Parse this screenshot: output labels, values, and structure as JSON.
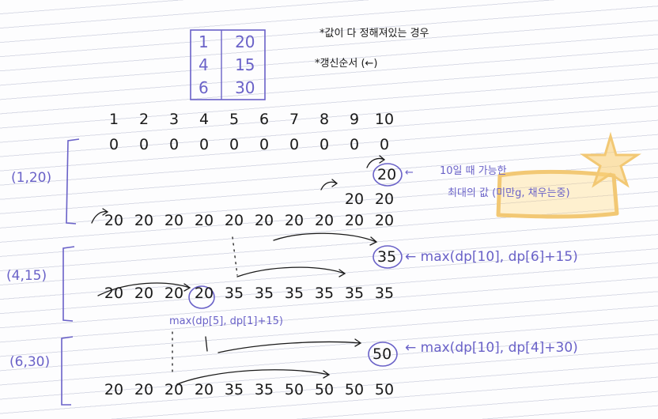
{
  "items": [
    {
      "weight": "1",
      "value": "20"
    },
    {
      "weight": "4",
      "value": "15"
    },
    {
      "weight": "6",
      "value": "30"
    }
  ],
  "notes": {
    "condition": "*값이 다 정해져있는 경우",
    "update_order": "*갱신순서 (←)"
  },
  "header": [
    "1",
    "2",
    "3",
    "4",
    "5",
    "6",
    "7",
    "8",
    "9",
    "10"
  ],
  "groups": [
    {
      "label": "(1,20)",
      "init_row": [
        "0",
        "0",
        "0",
        "0",
        "0",
        "0",
        "0",
        "0",
        "0",
        "0"
      ],
      "circled": "20",
      "note_lines": [
        "10일 때 가능한",
        "최대의 값 (미만g, 채우는중)"
      ],
      "mid_row": [
        "20",
        "20"
      ],
      "final_row": [
        "20",
        "20",
        "20",
        "20",
        "20",
        "20",
        "20",
        "20",
        "20",
        "20"
      ]
    },
    {
      "label": "(4,15)",
      "circled": "35",
      "formula": "← max(dp[10], dp[6]+15)",
      "final_row": [
        "20",
        "20",
        "20",
        "20",
        "35",
        "35",
        "35",
        "35",
        "35",
        "35"
      ],
      "sub_formula": "max(dp[5], dp[1]+15)"
    },
    {
      "label": "(6,30)",
      "circled": "50",
      "formula": "← max(dp[10], dp[4]+30)",
      "final_row": [
        "20",
        "20",
        "20",
        "20",
        "35",
        "35",
        "50",
        "50",
        "50",
        "50"
      ]
    }
  ]
}
